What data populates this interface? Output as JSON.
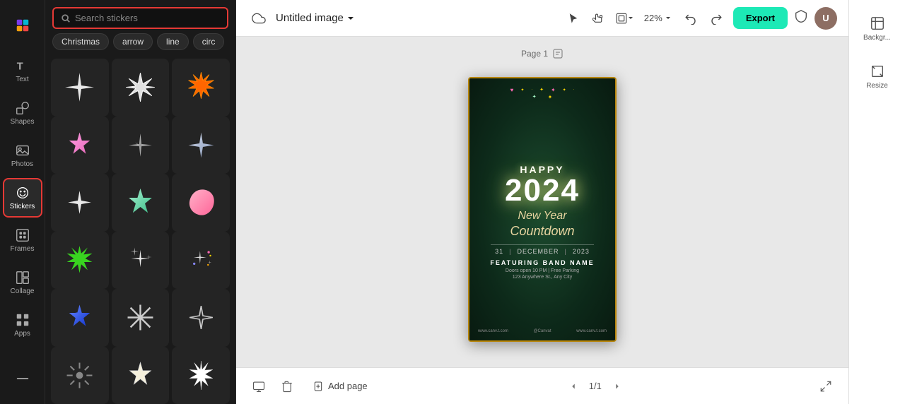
{
  "app": {
    "logo_label": "Canva"
  },
  "left_nav": {
    "items": [
      {
        "id": "text",
        "label": "Text",
        "icon": "text-icon"
      },
      {
        "id": "shapes",
        "label": "Shapes",
        "icon": "shapes-icon"
      },
      {
        "id": "photos",
        "label": "Photos",
        "icon": "photos-icon"
      },
      {
        "id": "stickers",
        "label": "Stickers",
        "icon": "stickers-icon",
        "active": true
      },
      {
        "id": "frames",
        "label": "Frames",
        "icon": "frames-icon"
      },
      {
        "id": "collage",
        "label": "Collage",
        "icon": "collage-icon"
      },
      {
        "id": "apps",
        "label": "Apps",
        "icon": "apps-icon"
      },
      {
        "id": "more",
        "label": "",
        "icon": "more-icon"
      }
    ]
  },
  "stickers_panel": {
    "search_placeholder": "Search stickers",
    "tags": [
      "Christmas",
      "arrow",
      "line",
      "circ"
    ],
    "rows": [
      [
        "4point-black",
        "starburst-white",
        "starburst-orange"
      ],
      [
        "star-pink",
        "4point-silver",
        "4point-silver2"
      ],
      [
        "4point-white2",
        "star-teal",
        "blob-pink"
      ],
      [
        "starburst-green",
        "sparkles-white",
        "sparkles-colorful"
      ],
      [
        "star-blue",
        "asterisk-white",
        "4point-outline"
      ],
      [
        "sun-dark",
        "star-cream",
        "starburst-white2"
      ]
    ]
  },
  "toolbar": {
    "cloud_title": "Untitled image",
    "chevron_label": "▾",
    "zoom_value": "22%",
    "undo_label": "Undo",
    "redo_label": "Redo",
    "export_label": "Export",
    "select_tool": "Select",
    "hand_tool": "Hand",
    "frame_tool": "Frame"
  },
  "canvas": {
    "page_label": "Page 1",
    "card": {
      "happy": "HAPPY",
      "year": "2024",
      "subtitle1": "New Year",
      "subtitle2": "Countdown",
      "date_day": "31",
      "date_month": "DECEMBER",
      "date_year": "2023",
      "featuring": "FEATURING BAND NAME",
      "doors": "Doors open 10 PM | Free Parking",
      "address": "123 Anywhere St., Any City",
      "url1": "www.canv.t.com",
      "url2": "@Canvat",
      "url3": "www.canv.t.com"
    }
  },
  "bottom_bar": {
    "add_page_label": "Add page",
    "page_indicator": "1/1"
  },
  "right_panel": {
    "items": [
      {
        "id": "background",
        "label": "Backgr..."
      },
      {
        "id": "resize",
        "label": "Resize"
      }
    ]
  }
}
